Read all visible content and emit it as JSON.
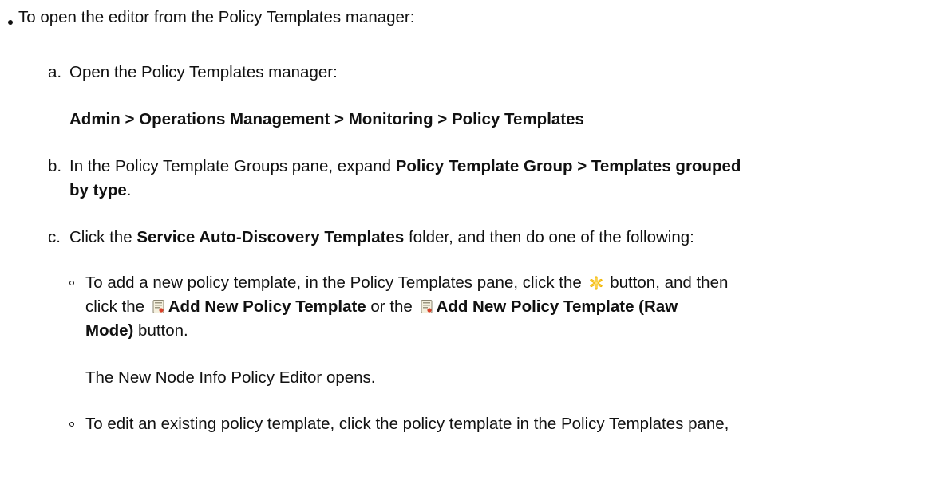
{
  "item_main": "To open the editor from the Policy Templates manager:",
  "steps": {
    "a": {
      "marker": "a.",
      "text": "Open the Policy Templates manager:",
      "path": "Admin > Operations Management > Monitoring > Policy Templates"
    },
    "b": {
      "marker": "b.",
      "text_pre": "In the Policy Template Groups pane, expand ",
      "bold_1": "Policy Template Group > Templates grouped",
      "bold_2": "by type",
      "text_post": "."
    },
    "c": {
      "marker": "c.",
      "text_pre": "Click the ",
      "bold": "Service Auto-Discovery Templates",
      "text_post": " folder, and then do one of the following:"
    }
  },
  "sub_items": {
    "add": {
      "line1_pre": "To add a new policy template, in the Policy Templates pane, click the ",
      "line1_post": " button, and then",
      "line2_pre": "click the ",
      "bold_1": "Add New Policy Template",
      "line2_mid": " or the ",
      "bold_2": "Add New Policy Template (Raw",
      "bold_3": "Mode)",
      "line3_post": " button.",
      "result": "The New Node Info Policy Editor opens."
    },
    "edit": {
      "text": "To edit an existing policy template, click the policy template in the Policy Templates pane,"
    }
  },
  "icons": {
    "new": "asterisk-new-icon",
    "template": "policy-template-icon"
  }
}
